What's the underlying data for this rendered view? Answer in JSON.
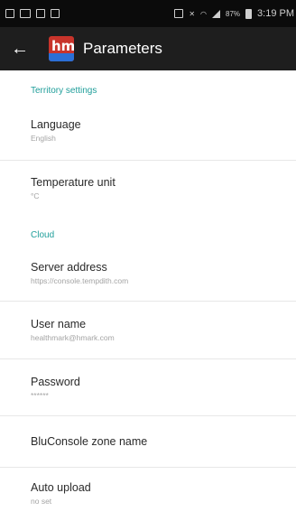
{
  "status_bar": {
    "battery": "87%",
    "time": "3:19 PM"
  },
  "app_bar": {
    "back_icon": "arrow-left-icon",
    "logo_text": "hm",
    "title": "Parameters"
  },
  "sections": {
    "territory": {
      "header": "Territory settings",
      "language": {
        "title": "Language",
        "value": "English"
      },
      "temperature_unit": {
        "title": "Temperature unit",
        "value": "°C"
      }
    },
    "cloud": {
      "header": "Cloud",
      "server_address": {
        "title": "Server address",
        "value": "https://console.tempdith.com"
      },
      "user_name": {
        "title": "User name",
        "value": "healthmark@hmark.com"
      },
      "password": {
        "title": "Password",
        "value": "******"
      },
      "zone_name": {
        "title": "BluConsole zone name"
      },
      "auto_upload": {
        "title": "Auto upload",
        "value": "no set"
      }
    }
  },
  "colors": {
    "section_header": "#1f9e9a",
    "app_bar": "#1e1e1e",
    "status_bar": "#0b0b0b"
  }
}
